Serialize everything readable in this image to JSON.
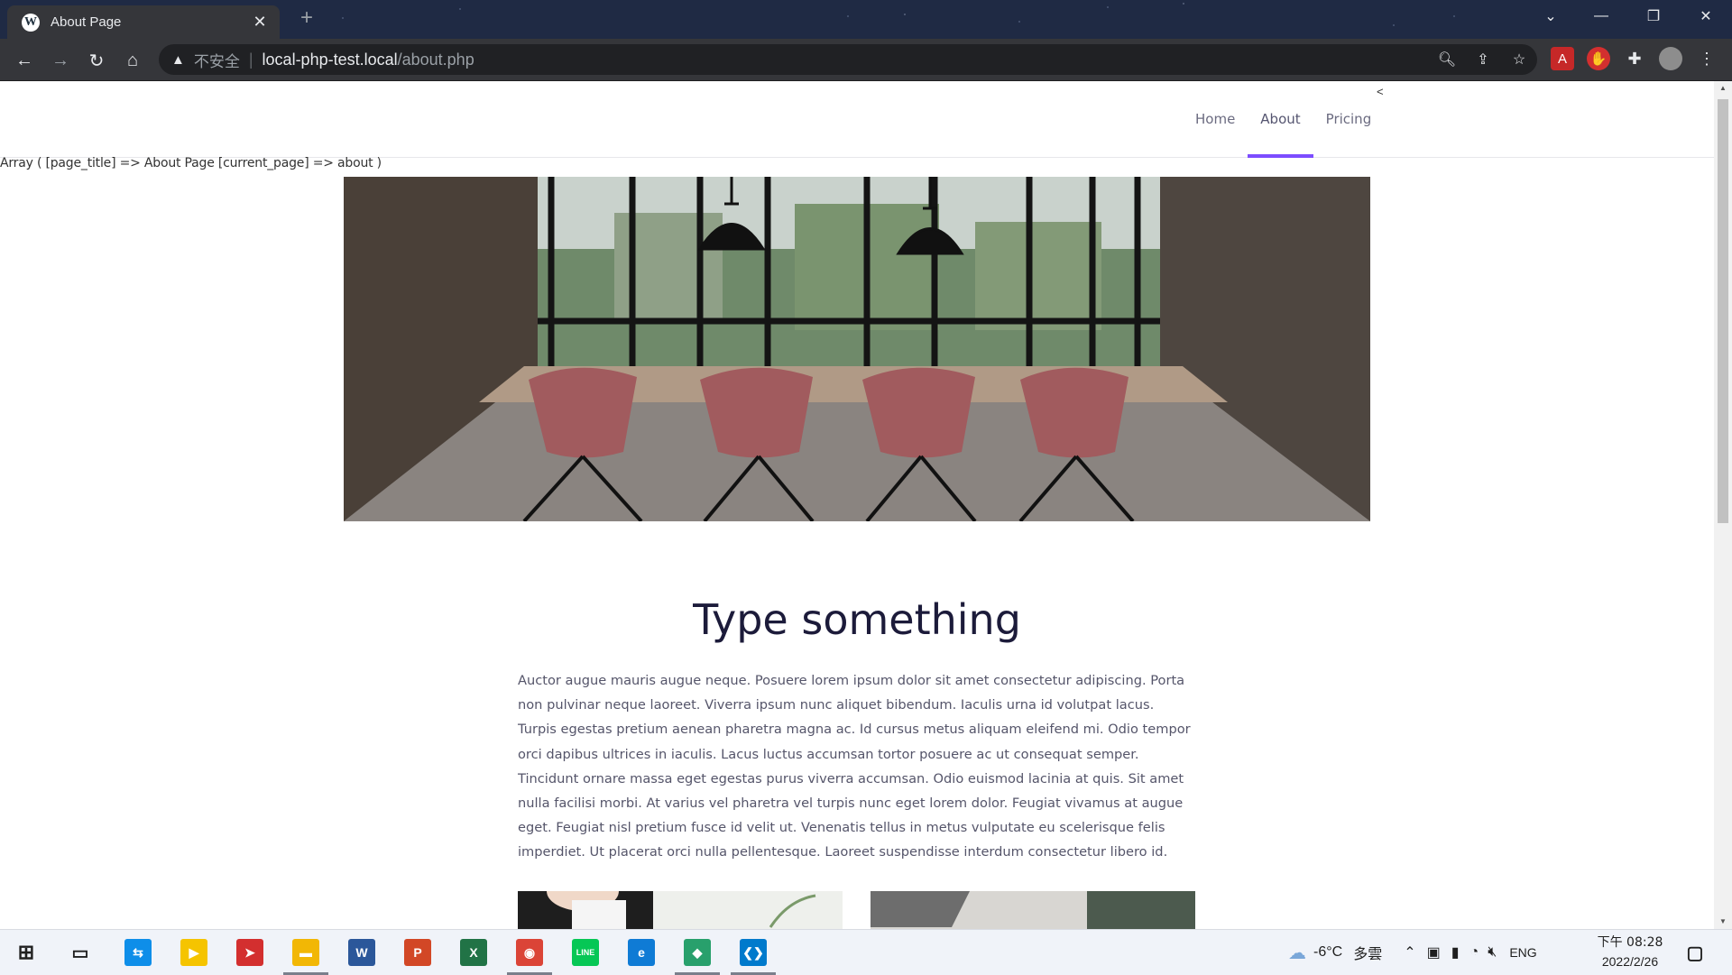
{
  "browser": {
    "tab_title": "About Page",
    "tab_close": "✕",
    "new_tab": "+",
    "insecure_label": "不安全",
    "url_host": "local-php-test.local",
    "url_path": "/about.php"
  },
  "site": {
    "nav": [
      {
        "label": "Home"
      },
      {
        "label": "About"
      },
      {
        "label": "Pricing"
      }
    ],
    "lt_mark": "<",
    "debug_output": "Array ( [page_title] => About Page [current_page] => about )",
    "content_title": "Type something",
    "content_body": "Auctor augue mauris augue neque. Posuere lorem ipsum dolor sit amet consectetur adipiscing. Porta non pulvinar neque laoreet. Viverra ipsum nunc aliquet bibendum. Iaculis urna id volutpat lacus. Turpis egestas pretium aenean pharetra magna ac. Id cursus metus aliquam eleifend mi. Odio tempor orci dapibus ultrices in iaculis. Lacus luctus accumsan tortor posuere ac ut consequat semper. Tincidunt ornare massa eget egestas purus viverra accumsan. Odio euismod lacinia at quis. Sit amet nulla facilisi morbi. At varius vel pharetra vel turpis nunc eget lorem dolor. Feugiat vivamus at augue eget. Feugiat nisl pretium fusce id velit ut. Venenatis tellus in metus vulputate eu scelerisque felis imperdiet. Ut placerat orci nulla pellentesque. Laoreet suspendisse interdum consectetur libero id."
  },
  "taskbar": {
    "weather_temp": "-6°C",
    "weather_desc": "多雲",
    "lang": "ENG",
    "time": "下午 08:28",
    "date": "2022/2/26",
    "apps": [
      {
        "name": "teamviewer",
        "glyph": "⇆",
        "color": "#0e8ee9"
      },
      {
        "name": "potplayer",
        "glyph": "▶",
        "color": "#f5c400"
      },
      {
        "name": "app-red-arrow",
        "glyph": "➤",
        "color": "#d32f2f"
      },
      {
        "name": "file-explorer",
        "glyph": "▬",
        "color": "#f2b705"
      },
      {
        "name": "word",
        "glyph": "W",
        "color": "#2b579a"
      },
      {
        "name": "powerpoint",
        "glyph": "P",
        "color": "#d24726"
      },
      {
        "name": "excel",
        "glyph": "X",
        "color": "#217346"
      },
      {
        "name": "chrome",
        "glyph": "◉",
        "color": "#db4437"
      },
      {
        "name": "line",
        "glyph": "LINE",
        "color": "#06c755"
      },
      {
        "name": "edge",
        "glyph": "e",
        "color": "#0f7bd5"
      },
      {
        "name": "app-green-diamond",
        "glyph": "◆",
        "color": "#28a06c"
      },
      {
        "name": "vscode",
        "glyph": "❮❯",
        "color": "#007acc"
      }
    ]
  },
  "colors": {
    "nav_accent": "#7c4dff",
    "title_color": "#1c1b3a"
  }
}
